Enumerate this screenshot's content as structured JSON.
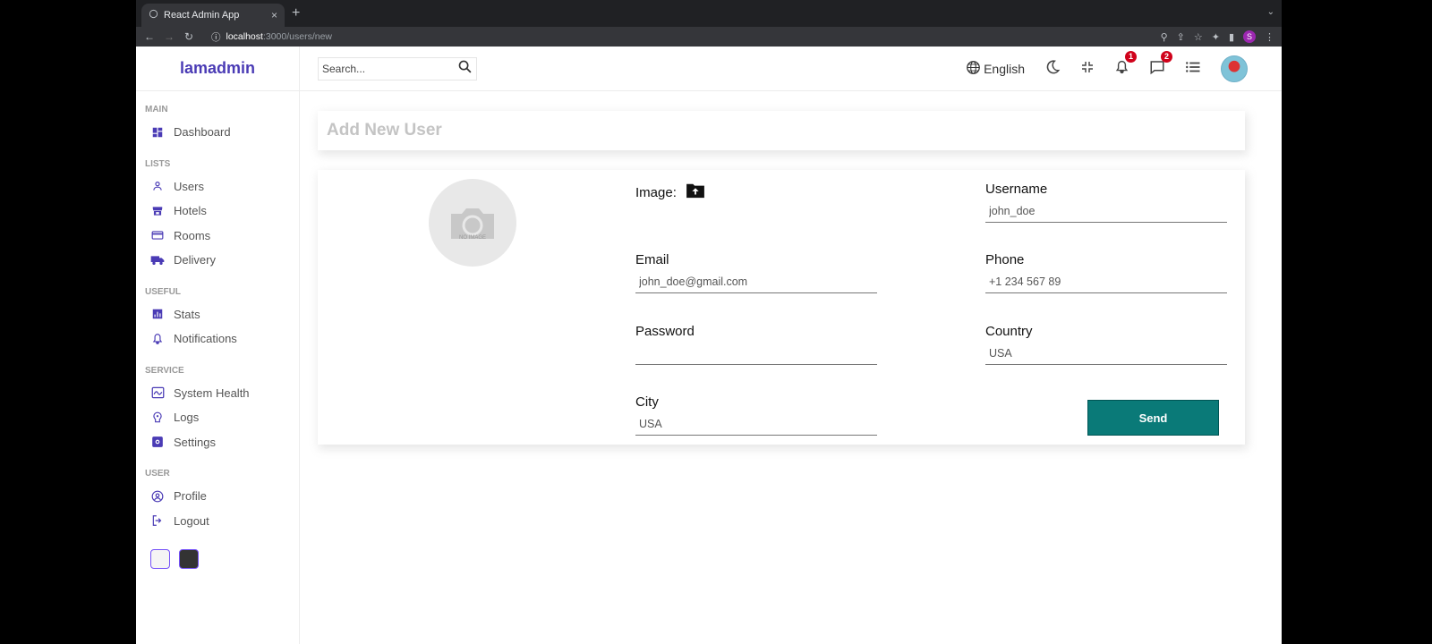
{
  "browser": {
    "tab_title": "React Admin App",
    "tab_close": "×",
    "new_tab": "+",
    "url_host": "localhost",
    "url_path": ":3000/users/new",
    "profile_initial": "S"
  },
  "sidebar": {
    "logo": "lamadmin",
    "sections": [
      {
        "title": "MAIN",
        "items": [
          {
            "label": "Dashboard",
            "icon": "dashboard-icon"
          }
        ]
      },
      {
        "title": "LISTS",
        "items": [
          {
            "label": "Users",
            "icon": "person-icon"
          },
          {
            "label": "Hotels",
            "icon": "store-icon"
          },
          {
            "label": "Rooms",
            "icon": "credit-card-icon"
          },
          {
            "label": "Delivery",
            "icon": "truck-icon"
          }
        ]
      },
      {
        "title": "USEFUL",
        "items": [
          {
            "label": "Stats",
            "icon": "bar-chart-icon"
          },
          {
            "label": "Notifications",
            "icon": "bell-icon"
          }
        ]
      },
      {
        "title": "SERVICE",
        "items": [
          {
            "label": "System Health",
            "icon": "health-icon"
          },
          {
            "label": "Logs",
            "icon": "psychology-icon"
          },
          {
            "label": "Settings",
            "icon": "settings-icon"
          }
        ]
      },
      {
        "title": "USER",
        "items": [
          {
            "label": "Profile",
            "icon": "account-circle-icon"
          },
          {
            "label": "Logout",
            "icon": "logout-icon"
          }
        ]
      }
    ],
    "theme_colors": [
      "#f5f5f5",
      "#333333"
    ]
  },
  "navbar": {
    "search_placeholder": "Search...",
    "language": "English",
    "notifications_count": "1",
    "messages_count": "2"
  },
  "page": {
    "title": "Add New User",
    "no_image_text": "NO IMAGE",
    "image_label": "Image:",
    "fields": {
      "username": {
        "label": "Username",
        "placeholder": "john_doe"
      },
      "email": {
        "label": "Email",
        "placeholder": "john_doe@gmail.com"
      },
      "phone": {
        "label": "Phone",
        "placeholder": "+1 234 567 89"
      },
      "password": {
        "label": "Password",
        "placeholder": ""
      },
      "country": {
        "label": "Country",
        "placeholder": "USA"
      },
      "city": {
        "label": "City",
        "placeholder": "USA"
      }
    },
    "send_label": "Send",
    "accent_color": "#0a7a78",
    "brand_color": "#4a3bb5"
  }
}
